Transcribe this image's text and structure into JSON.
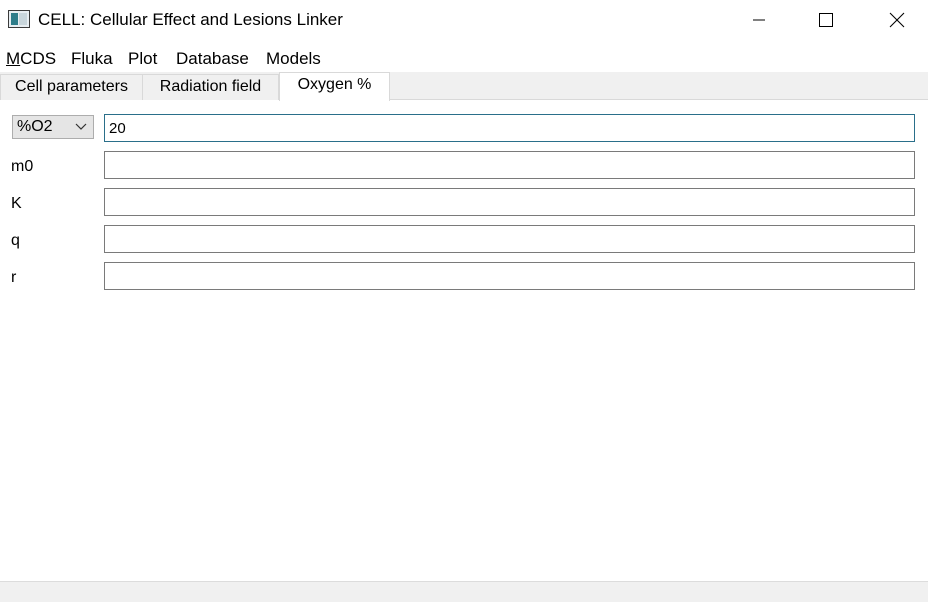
{
  "window": {
    "title": "CELL: Cellular Effect and Lesions Linker"
  },
  "menubar": {
    "items": [
      {
        "mnemonic": "M",
        "rest": "CDS"
      },
      {
        "label": "Fluka"
      },
      {
        "label": "Plot"
      },
      {
        "label": "Database"
      },
      {
        "label": "Models"
      }
    ]
  },
  "tabs": [
    {
      "label": "Cell parameters",
      "active": false
    },
    {
      "label": "Radiation field",
      "active": false
    },
    {
      "label": "Oxygen %",
      "active": true
    }
  ],
  "oxygen": {
    "unit_select": {
      "selected": "%O2"
    },
    "o2_value": "20",
    "fields": [
      {
        "label": "m0",
        "value": ""
      },
      {
        "label": "K",
        "value": ""
      },
      {
        "label": "q",
        "value": ""
      },
      {
        "label": "r",
        "value": ""
      }
    ]
  },
  "icons": {
    "app": "app-icon",
    "minimize": "minimize-icon",
    "maximize": "maximize-icon",
    "close": "close-icon",
    "dropdown": "chevron-down-icon"
  },
  "colors": {
    "tab_bar_bg": "#f0f0f0",
    "focus_border": "#2a6f8a",
    "input_border": "#7a7a7a"
  }
}
